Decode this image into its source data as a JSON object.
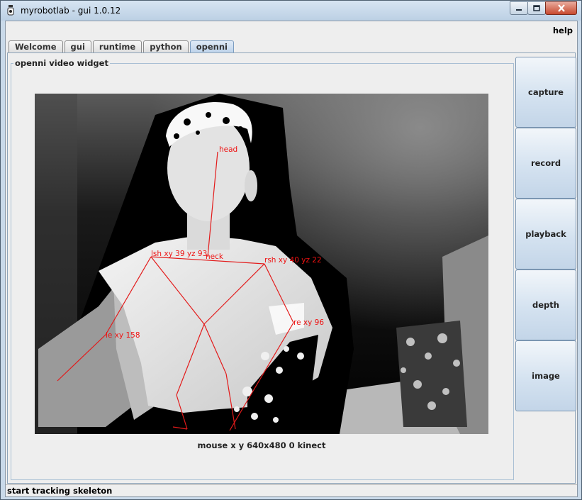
{
  "window": {
    "title": "myrobotlab - gui 1.0.12"
  },
  "menu": {
    "help": "help"
  },
  "tabs": [
    {
      "label": "Welcome"
    },
    {
      "label": "gui"
    },
    {
      "label": "runtime"
    },
    {
      "label": "python"
    },
    {
      "label": "openni",
      "active": true
    }
  ],
  "widget": {
    "title": "openni  video widget"
  },
  "video": {
    "joints": {
      "head": "head",
      "neck": "neck",
      "lsh": "lsh xy 39 yz 93",
      "rsh": "rsh xy 40 yz 22",
      "le": "le xy 158",
      "re": "re xy 96"
    },
    "skeleton_color": "#e31a1a"
  },
  "video_status": "mouse x y  640x480  0  kinect",
  "side_buttons": {
    "capture": "capture",
    "record": "record",
    "playback": "playback",
    "depth": "depth",
    "image": "image"
  },
  "status": "start tracking skeleton"
}
